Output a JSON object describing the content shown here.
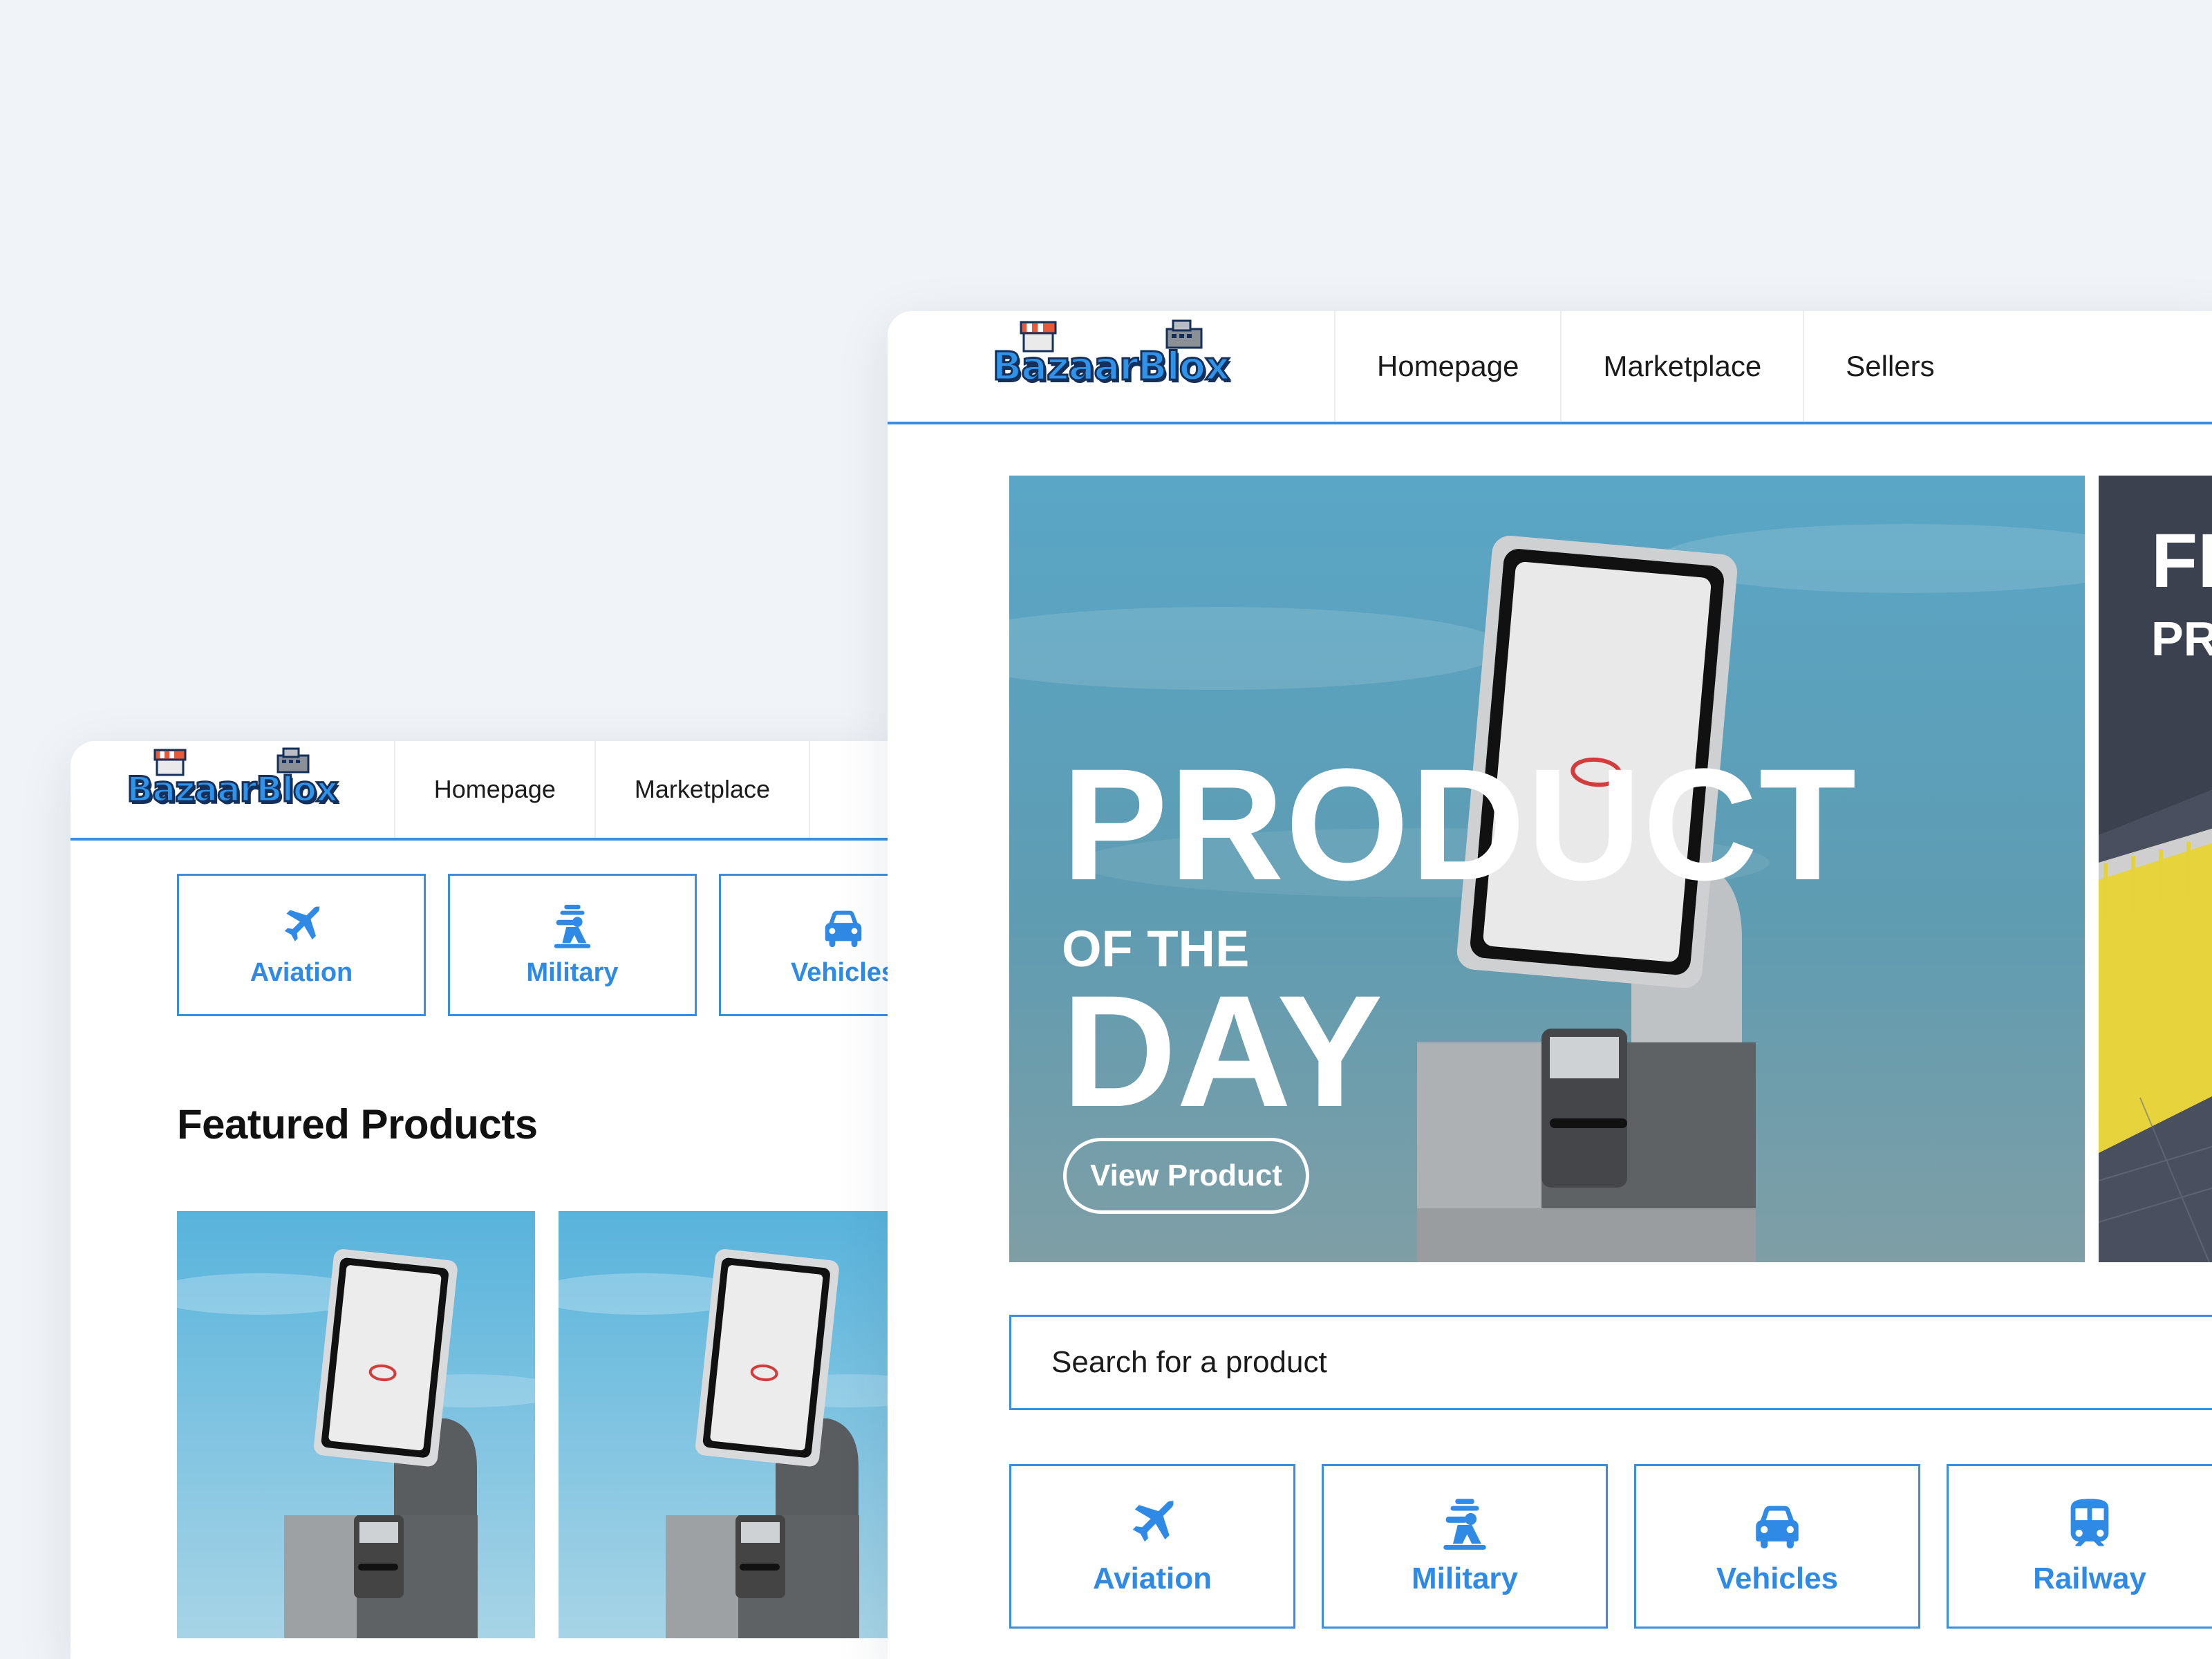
{
  "brand": {
    "logo_text": "BazaarBlox"
  },
  "colors": {
    "accent": "#3b8de0",
    "page_bg": "#f0f3f7",
    "text": "#1b1b1b"
  },
  "front_window": {
    "nav": {
      "items": [
        "Homepage",
        "Marketplace"
      ]
    },
    "categories": [
      {
        "label": "Aviation",
        "icon": "airplane-icon"
      },
      {
        "label": "Military",
        "icon": "soldier-icon"
      },
      {
        "label": "Vehicles",
        "icon": "car-icon"
      }
    ],
    "featured_title": "Featured Products"
  },
  "back_window": {
    "nav": {
      "items": [
        "Homepage",
        "Marketplace",
        "Sellers"
      ]
    },
    "hero": {
      "line1": "PRODUCT",
      "line2": "OF THE",
      "line3": "DAY",
      "button_label": "View Product",
      "next_slide_line1": "FI",
      "next_slide_line2": "PR"
    },
    "search": {
      "placeholder": "Search for a product"
    },
    "categories": [
      {
        "label": "Aviation",
        "icon": "airplane-icon"
      },
      {
        "label": "Military",
        "icon": "soldier-icon"
      },
      {
        "label": "Vehicles",
        "icon": "car-icon"
      },
      {
        "label": "Railway",
        "icon": "train-icon"
      }
    ]
  }
}
